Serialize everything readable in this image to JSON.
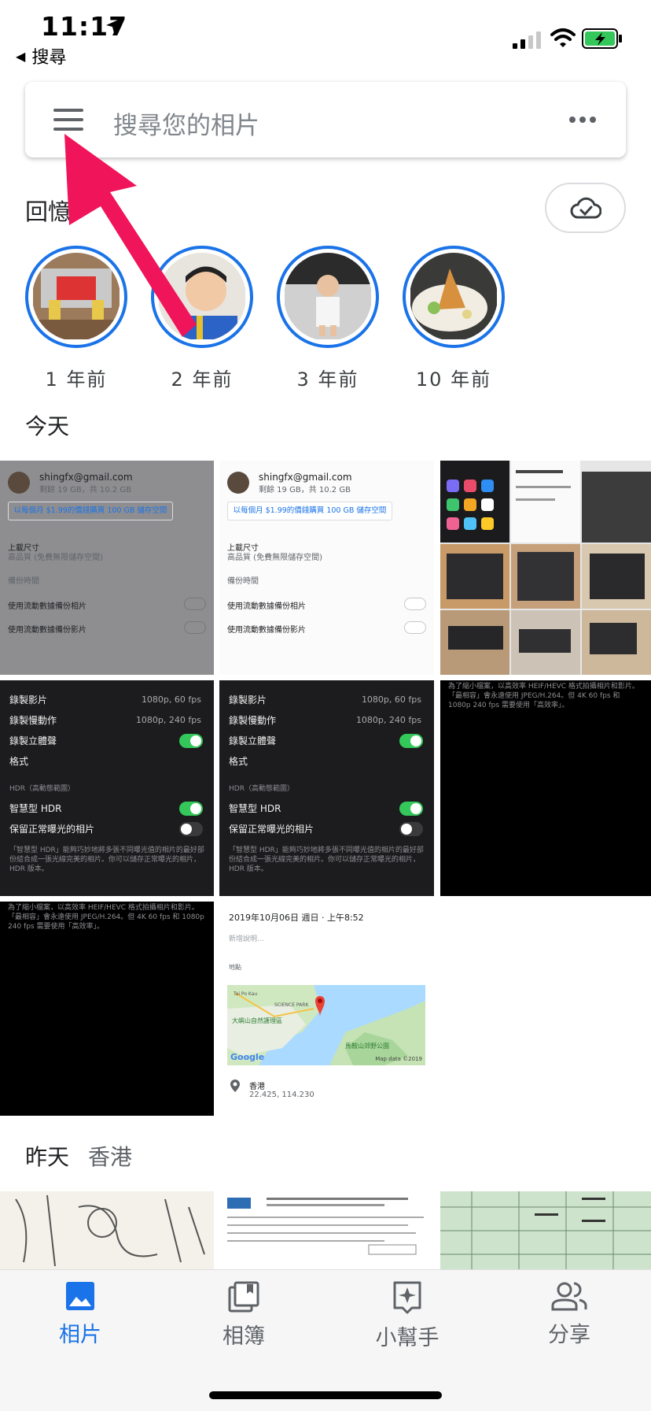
{
  "status_bar": {
    "time": "11:17",
    "back_label": "搜尋"
  },
  "search": {
    "placeholder": "搜尋您的相片"
  },
  "memories": {
    "title": "回憶",
    "items": [
      {
        "label": "1 年前"
      },
      {
        "label": "2 年前"
      },
      {
        "label": "3 年前"
      },
      {
        "label": "10 年前"
      }
    ]
  },
  "today": {
    "title": "今天"
  },
  "settings_tile": {
    "email": "shingfx@gmail.com",
    "quota": "剩餘 19 GB，共 10.2 GB",
    "buy_label": "以每個月 $1.99的價錢購買 100 GB 儲存空間",
    "upload_size": "上載尺寸",
    "upload_quality": "高品質 (免費無限儲存空間)",
    "backup_time": "備份時間",
    "mobile_photos": "使用流動數據備份相片",
    "mobile_videos": "使用流動數據備份影片"
  },
  "camera_tile": {
    "record_video": "錄製影片",
    "record_video_val": "1080p, 60 fps",
    "record_slomo": "錄製慢動作",
    "record_slomo_val": "1080p, 240 fps",
    "stereo": "錄製立體聲",
    "format": "格式",
    "hdr_header": "HDR（高動態範圍）",
    "smart_hdr": "智慧型 HDR",
    "keep_normal": "保留正常曝光的相片",
    "hdr_note": "「智慧型 HDR」能夠巧妙地將多張不同曝光值的相片的最好部份結合成一張光線完美的相片。你可以儲存正常曝光的相片，HDR 版本。"
  },
  "black_tile": {
    "note": "為了縮小檔案，以高效率 HEIF/HEVC 格式拍攝相片和影片。「最相容」會永遠使用 JPEG/H.264。但 4K 60 fps 和 1080p 240 fps 需要使用「高效率」。"
  },
  "info_tile": {
    "date": "2019年10月06日 週日 · 上午8:52",
    "desc_placeholder": "新增說明...",
    "location_label": "地點",
    "map_labels": [
      "大嶼山自然護理區",
      "SCIENCE PARK",
      "馬鞍山郊野公園",
      "Tai Po Kau"
    ],
    "map_attrib": "Map data ©2019",
    "google": "Google",
    "place": "香港",
    "coords": "22.425, 114.230"
  },
  "yesterday": {
    "title": "昨天",
    "location": "香港"
  },
  "bottom_nav": {
    "items": [
      {
        "label": "相片",
        "active": true
      },
      {
        "label": "相簿",
        "active": false
      },
      {
        "label": "小幫手",
        "active": false
      },
      {
        "label": "分享",
        "active": false
      }
    ]
  },
  "colors": {
    "accent": "#1a73e8",
    "annotation_arrow": "#f0145a",
    "toggle_on": "#34c759"
  }
}
